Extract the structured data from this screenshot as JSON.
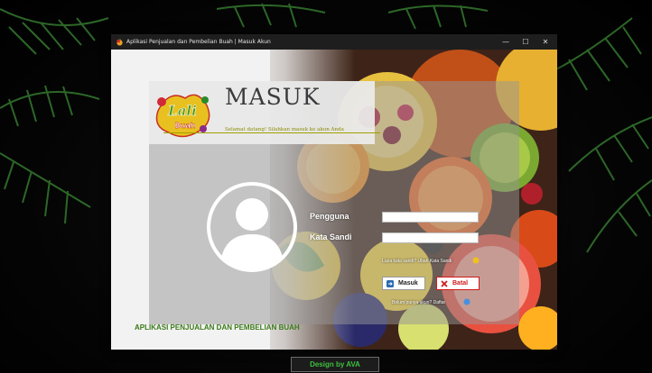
{
  "window": {
    "title": "Aplikasi Penjualan dan Pembelian Buah | Masuk Akun",
    "minimize": "—",
    "maximize": "☐",
    "close": "✕"
  },
  "logo": {
    "line1": "Lali",
    "line2": "Buah"
  },
  "header": {
    "title": "MASUK",
    "welcome": "Selamat datang! Silahkan masuk ke akun Anda"
  },
  "form": {
    "username_label": "Pengguna",
    "password_label": "Kata Sandi",
    "username_value": "",
    "password_value": "",
    "forgot_text": "Lupa kata sandi?",
    "forgot_link": "Ubah Kata Sandi",
    "login_label": "Masuk",
    "cancel_label": "Batal",
    "register_text": "Belum punya akun?",
    "register_link": "Daftar"
  },
  "footer": {
    "app_name": "APLIKASI PENJUALAN DAN PEMBELIAN BUAH"
  },
  "credit": "Design by AVA",
  "colors": {
    "accent_green": "#3a7a18",
    "credit_green": "#3ec03e",
    "cancel_red": "#d01a1a",
    "title_bar": "#1e1e1e"
  },
  "icons": {
    "app": "fruit-app-icon",
    "avatar": "user-avatar-icon",
    "login": "login-icon",
    "cancel": "cancel-x-icon",
    "forgot": "emoji-icon",
    "register": "emoji-icon"
  }
}
